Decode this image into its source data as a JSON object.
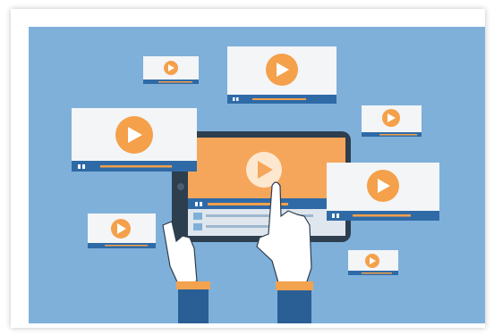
{
  "illustration": {
    "colors": {
      "background": "#7fb0da",
      "card_face": "#f3f5f7",
      "card_bar": "#2f6aa7",
      "accent_orange": "#f5a04a",
      "tablet_body": "#2d3e4f",
      "tablet_screen": "#f6a65a",
      "hand": "#ffffff",
      "cuff_orange": "#f3a24e",
      "sleeve": "#2a5f96"
    },
    "icons": [
      "play-icon",
      "pause-icon",
      "tablet-icon",
      "hand-icon"
    ]
  }
}
